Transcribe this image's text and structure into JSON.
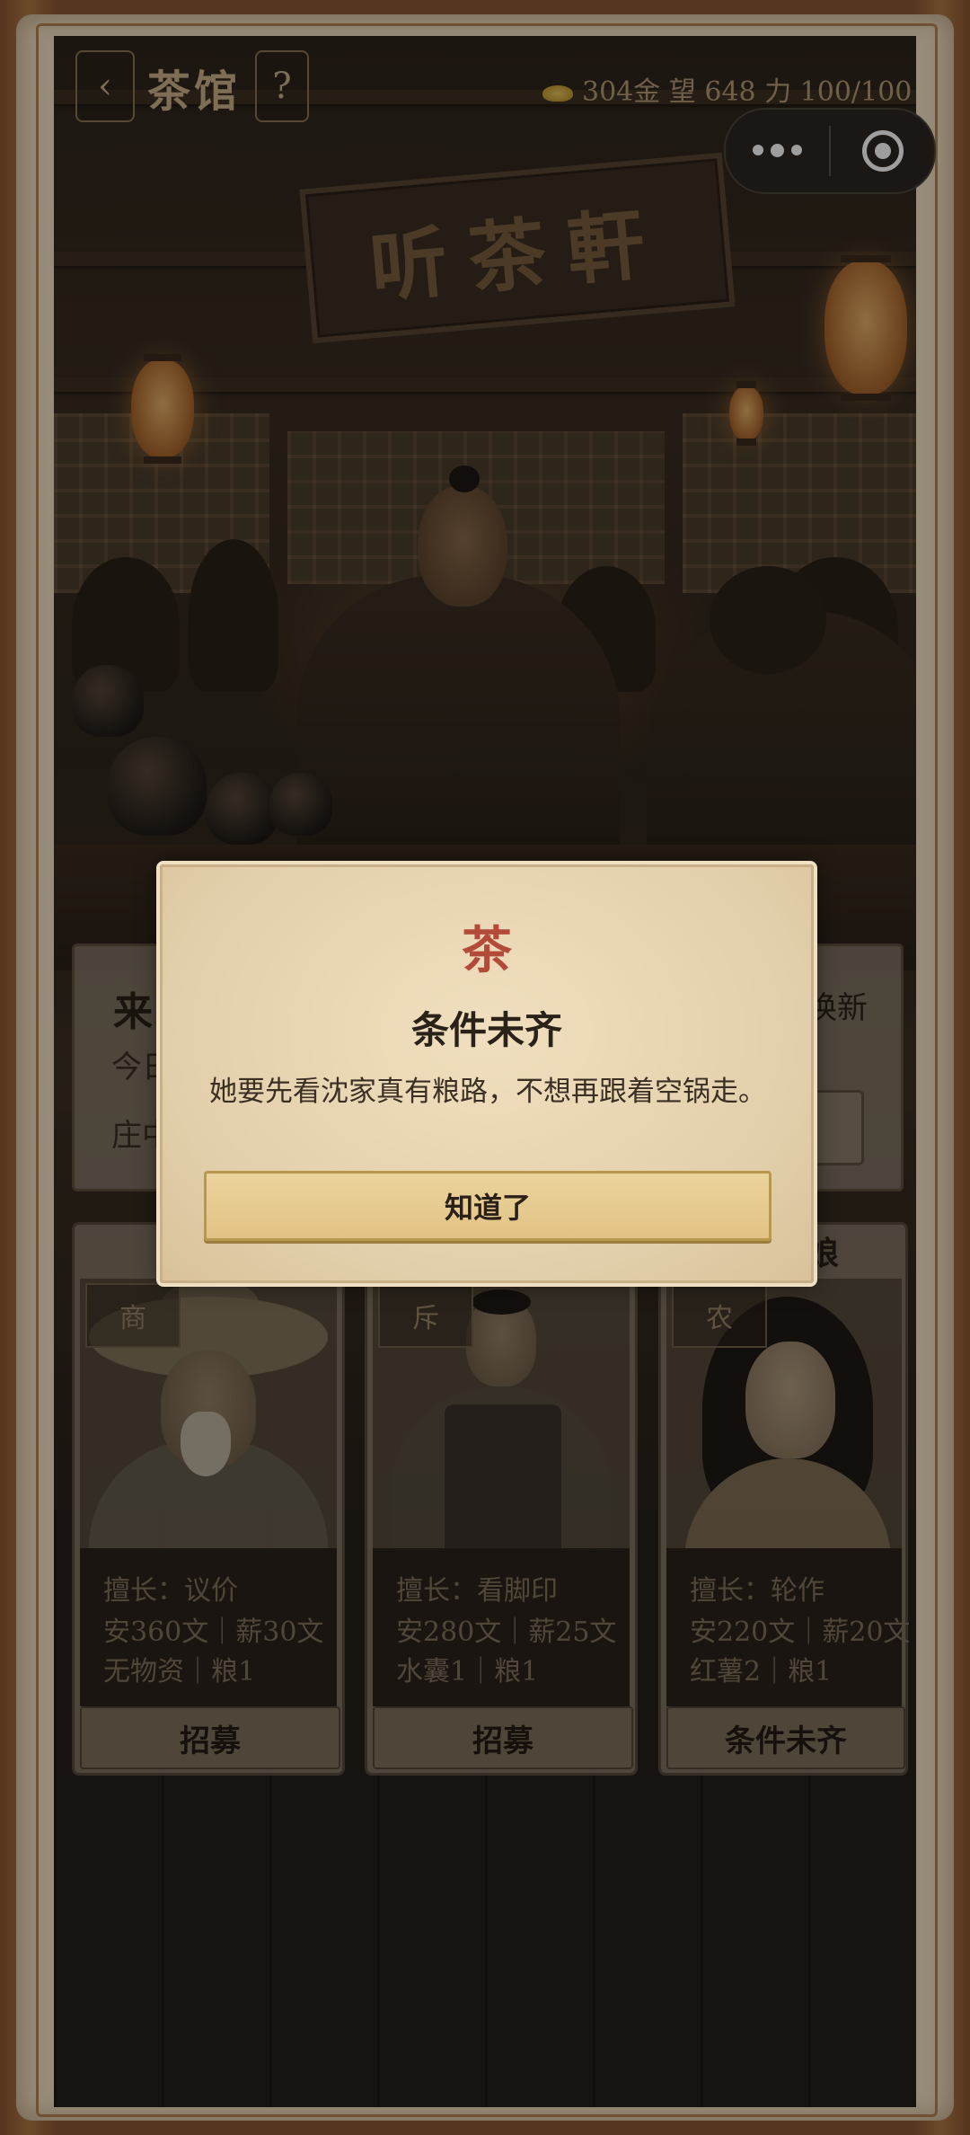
{
  "header": {
    "back_icon": "‹",
    "title": "茶馆",
    "help_icon": "?",
    "resources": "304金 望 648 力 100/100"
  },
  "scene": {
    "sign_text": "听茶軒"
  },
  "info_panel": {
    "title_fragment": "来",
    "line1_fragment": "今日",
    "line2_fragment": "庄中",
    "right_fragment": "换新"
  },
  "cards": [
    {
      "tag": "商",
      "line1": "擅长：议价",
      "line2": "安360文｜薪30文",
      "line3": "无物资｜粮1",
      "button": "招募"
    },
    {
      "tag": "斥",
      "line1": "擅长：看脚印",
      "line2": "安280文｜薪25文",
      "line3": "水囊1｜粮1",
      "button": "招募"
    },
    {
      "tag": "农",
      "line1": "擅长：轮作",
      "line2": "安220文｜薪20文",
      "line3": "红薯2｜粮1",
      "button": "条件未齐",
      "name_fragment": "娘"
    }
  ],
  "modal": {
    "glyph": "茶",
    "title": "条件未齐",
    "message": "她要先看沈家真有粮路，不想再跟着空锅走。",
    "button": "知道了"
  },
  "colors": {
    "accent_red": "#b44a3a",
    "button_gold": "#e2c385",
    "parchment": "#f2e2c4"
  },
  "icons": [
    "back-icon",
    "help-icon",
    "coin-icon",
    "more-dots-icon",
    "target-icon"
  ]
}
